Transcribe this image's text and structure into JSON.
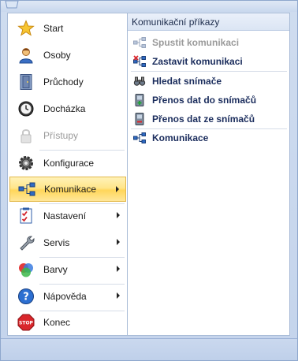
{
  "main_menu": {
    "items": [
      {
        "label": "Start",
        "icon": "star-icon",
        "disabled": false
      },
      {
        "label": "Osoby",
        "icon": "person-icon",
        "disabled": false
      },
      {
        "label": "Průchody",
        "icon": "door-icon",
        "disabled": false
      },
      {
        "label": "Docházka",
        "icon": "clock-icon",
        "disabled": false
      },
      {
        "label": "Přístupy",
        "icon": "lock-icon",
        "disabled": true
      },
      {
        "label": "Konfigurace",
        "icon": "gear-icon",
        "disabled": false
      },
      {
        "label": "Komunikace",
        "icon": "network-icon",
        "disabled": false,
        "selected": true,
        "submenu": true
      },
      {
        "label": "Nastavení",
        "icon": "checklist-icon",
        "disabled": false,
        "submenu": true
      },
      {
        "label": "Servis",
        "icon": "wrench-icon",
        "disabled": false,
        "submenu": true
      },
      {
        "label": "Barvy",
        "icon": "colors-icon",
        "disabled": false,
        "submenu": true
      },
      {
        "label": "Nápověda",
        "icon": "help-icon",
        "disabled": false,
        "submenu": true
      },
      {
        "label": "Konec",
        "icon": "stop-icon",
        "disabled": false
      }
    ]
  },
  "sub_menu": {
    "title": "Komunikační příkazy",
    "items": [
      {
        "label": "Spustit komunikaci",
        "icon": "network-start-icon",
        "disabled": true
      },
      {
        "label": "Zastavit komunikaci",
        "icon": "network-stop-icon",
        "disabled": false
      },
      {
        "label": "Hledat snímače",
        "icon": "binoculars-icon",
        "disabled": false
      },
      {
        "label": "Přenos dat do snímačů",
        "icon": "upload-reader-icon",
        "disabled": false
      },
      {
        "label": "Přenos dat ze snímačů",
        "icon": "download-reader-icon",
        "disabled": false
      },
      {
        "label": "Komunikace",
        "icon": "network-icon",
        "disabled": false
      }
    ]
  },
  "colors": {
    "selected_bg": "#ffe58a",
    "selected_border": "#e3b94b",
    "frame": "#c4d4ec",
    "submenu_text": "#1a2c5c",
    "disabled_text": "#9a9a9a"
  }
}
